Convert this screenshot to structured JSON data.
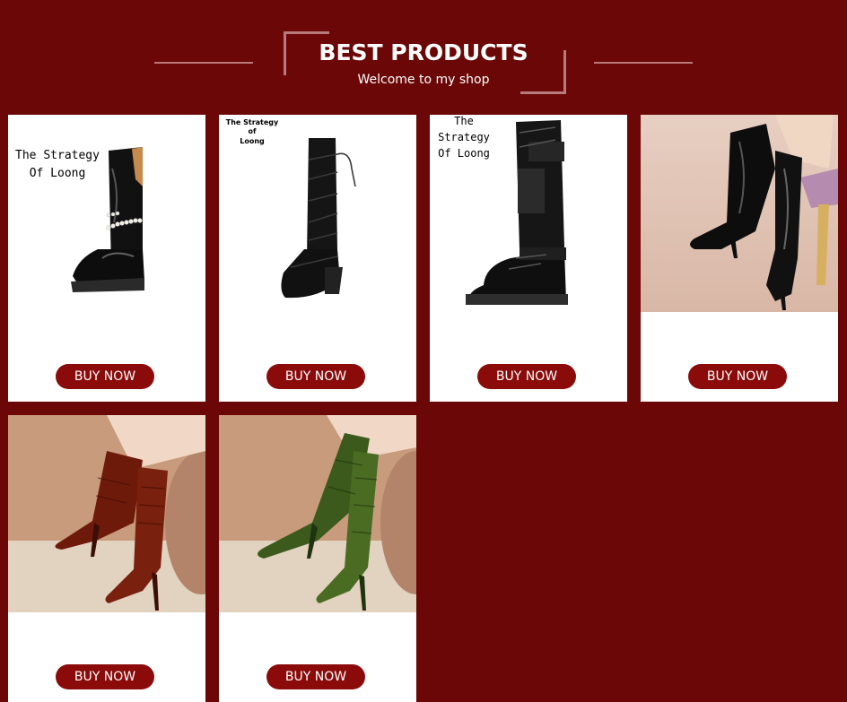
{
  "header": {
    "title": "BEST PRODUCTS",
    "subtitle": "Welcome to my shop"
  },
  "colors": {
    "background": "#6b0707",
    "button": "#8b0b0b",
    "ornament": "#b87a7a"
  },
  "products": [
    {
      "brand_text": "The Strategy\nOf Loong",
      "image": "black-patent-knee-boot-with-pearl-chain-photo",
      "button_label": "BUY NOW"
    },
    {
      "brand_text": "The Strategy of\nLoong",
      "image": "black-lace-up-knee-boot-photo",
      "button_label": "BUY NOW"
    },
    {
      "brand_text": "The Strategy\nOf Loong",
      "image": "black-combat-knee-boot-with-pockets-photo",
      "button_label": "BUY NOW"
    },
    {
      "brand_text": "",
      "image": "black-patent-lace-up-heeled-boots-photo",
      "button_label": "BUY NOW"
    },
    {
      "brand_text": "",
      "image": "brown-croc-stiletto-knee-boots-photo",
      "button_label": "BUY NOW"
    },
    {
      "brand_text": "",
      "image": "green-croc-stiletto-knee-boots-photo",
      "button_label": "BUY NOW"
    }
  ]
}
